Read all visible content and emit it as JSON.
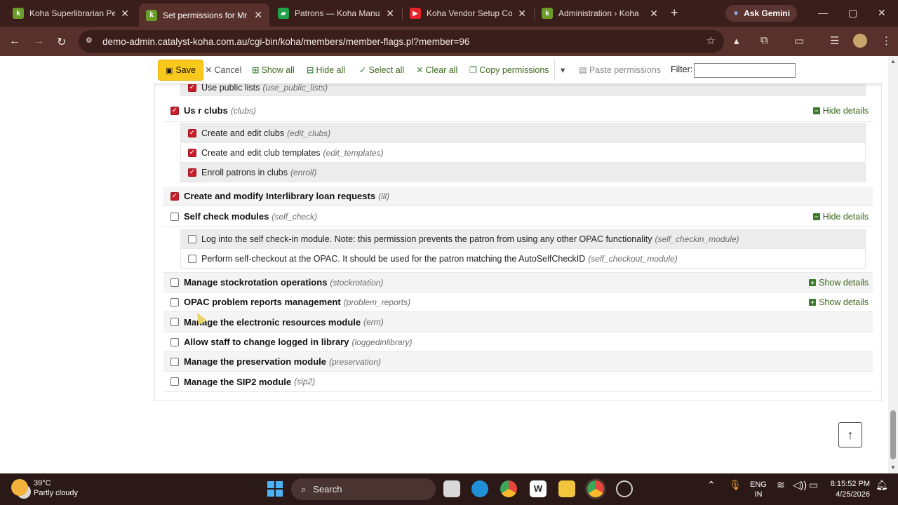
{
  "browser": {
    "tabs": [
      {
        "title": "Koha Superlibrarian Perm",
        "favicon": "koha-favicon"
      },
      {
        "title": "Set permissions for Mr S",
        "favicon": "koha-favicon"
      },
      {
        "title": "Patrons — Koha Manual",
        "favicon": "book-favicon"
      },
      {
        "title": "Koha Vendor Setup Com",
        "favicon": "youtube-favicon"
      },
      {
        "title": "Administration › Koha",
        "favicon": "koha-favicon"
      }
    ],
    "active_tab_index": 1,
    "gemini_label": "Ask Gemini",
    "url": "demo-admin.catalyst-koha.com.au/cgi-bin/koha/members/member-flags.pl?member=96"
  },
  "toolbar": {
    "save": "Save",
    "cancel": "Cancel",
    "show_all": "Show all",
    "hide_all": "Hide all",
    "select_all": "Select all",
    "clear_all": "Clear all",
    "copy_permissions": "Copy permissions",
    "paste_permissions": "Paste permissions",
    "filter_label": "Filter:",
    "filter_value": ""
  },
  "permissions": {
    "partial_sub": {
      "label": "Use public lists",
      "code": "(use_public_lists)",
      "checked": true
    },
    "clubs": {
      "label": "Us  r clubs",
      "code": "(clubs)",
      "checked": true,
      "details_link": "Hide details",
      "subs": [
        {
          "label": "Create and edit clubs",
          "code": "(edit_clubs)",
          "checked": true
        },
        {
          "label": "Create and edit club templates",
          "code": "(edit_templates)",
          "checked": true
        },
        {
          "label": "Enroll patrons in clubs",
          "code": "(enroll)",
          "checked": true
        }
      ]
    },
    "ill": {
      "label": "Create and modify Interlibrary loan requests",
      "code": "(ill)",
      "checked": true
    },
    "self_check": {
      "label": "Self check modules",
      "code": "(self_check)",
      "checked": false,
      "details_link": "Hide details",
      "subs": [
        {
          "label": "Log into the self check-in module. Note: this permission prevents the patron from using any other OPAC functionality",
          "code": "(self_checkin_module)",
          "checked": false
        },
        {
          "label": "Perform self-checkout at the OPAC. It should be used for the patron matching the AutoSelfCheckID",
          "code": "(self_checkout_module)",
          "checked": false
        }
      ]
    },
    "stockrotation": {
      "label": "Manage stockrotation operations",
      "code": "(stockrotation)",
      "checked": false,
      "details_link": "Show details"
    },
    "problem_reports": {
      "label": "OPAC problem reports management",
      "code": "(problem_reports)",
      "checked": false,
      "details_link": "Show details"
    },
    "erm": {
      "label": "Manage the electronic resources module",
      "code": "(erm)",
      "checked": false
    },
    "loggedinlibrary": {
      "label": "Allow staff to change logged in library",
      "code": "(loggedinlibrary)",
      "checked": false
    },
    "preservation": {
      "label": "Manage the preservation module",
      "code": "(preservation)",
      "checked": false
    },
    "sip2": {
      "label": "Manage the SIP2 module",
      "code": "(sip2)",
      "checked": false
    }
  },
  "taskbar": {
    "temperature": "39°C",
    "weather": "Partly cloudy",
    "search_placeholder": "Search",
    "lang_top": "ENG",
    "lang_bottom": "IN",
    "time": "8:15:52 PM",
    "date": "4/25/2026"
  },
  "colors": {
    "chrome_dark": "#3a1e1b",
    "chrome_mid": "#58302c",
    "save_yellow": "#f9c81c",
    "checkbox_red": "#c81e2a",
    "link_green": "#3f6b1f"
  }
}
